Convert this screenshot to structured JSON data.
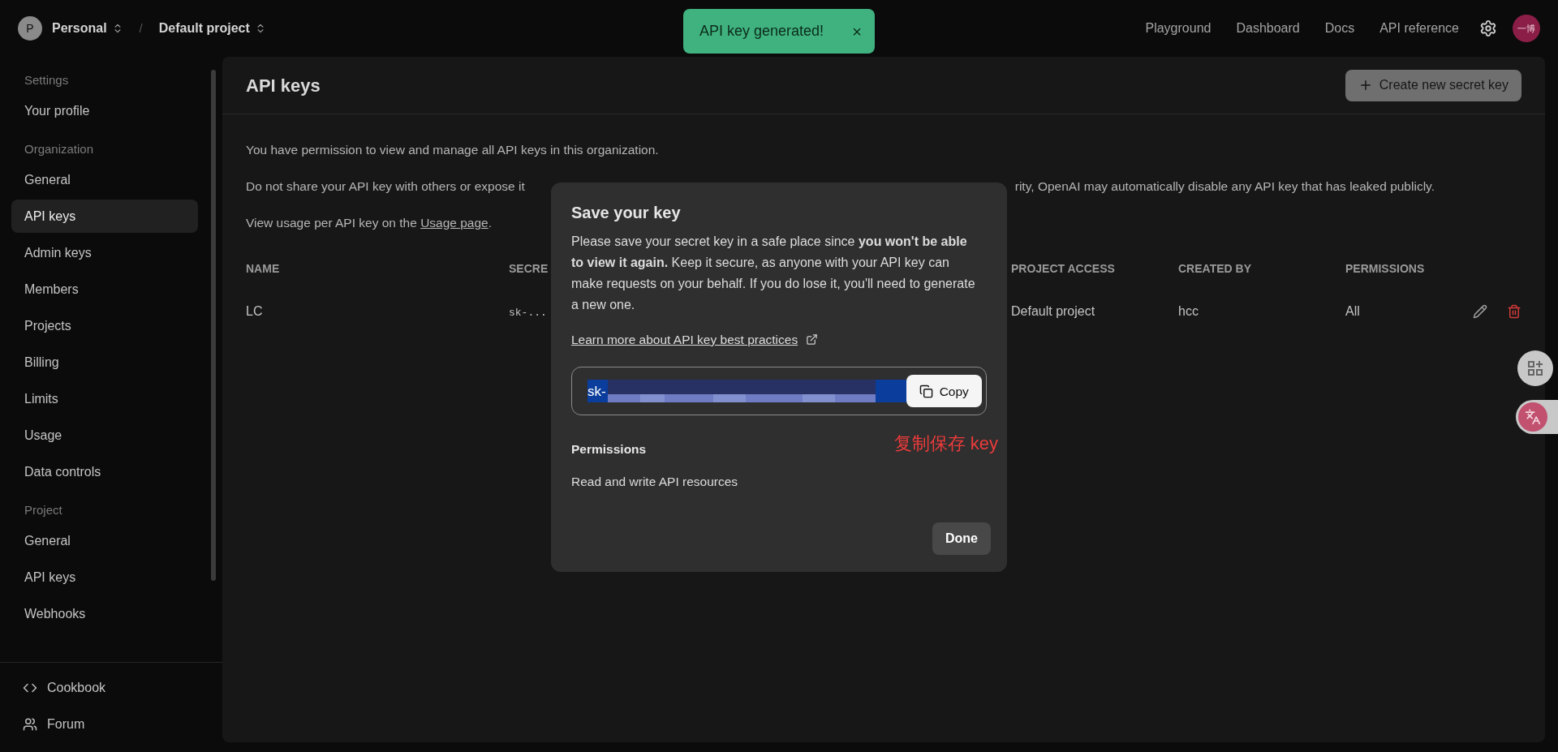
{
  "top_bar": {
    "org": {
      "initial": "P",
      "name": "Personal"
    },
    "separator": "/",
    "project": "Default project",
    "nav": [
      "Playground",
      "Dashboard",
      "Docs",
      "API reference"
    ],
    "avatar": "一博"
  },
  "toast": {
    "message": "API key generated!",
    "close": "×"
  },
  "sidebar": {
    "sections": [
      {
        "heading": "Settings",
        "items": [
          {
            "label": "Your profile",
            "selected": false
          }
        ]
      },
      {
        "heading": "Organization",
        "items": [
          {
            "label": "General",
            "selected": false
          },
          {
            "label": "API keys",
            "selected": true
          },
          {
            "label": "Admin keys",
            "selected": false
          },
          {
            "label": "Members",
            "selected": false
          },
          {
            "label": "Projects",
            "selected": false
          },
          {
            "label": "Billing",
            "selected": false
          },
          {
            "label": "Limits",
            "selected": false
          },
          {
            "label": "Usage",
            "selected": false
          },
          {
            "label": "Data controls",
            "selected": false
          }
        ]
      },
      {
        "heading": "Project",
        "items": [
          {
            "label": "General",
            "selected": false
          },
          {
            "label": "API keys",
            "selected": false
          },
          {
            "label": "Webhooks",
            "selected": false
          }
        ]
      }
    ],
    "footer": [
      {
        "label": "Cookbook",
        "kind": "code"
      },
      {
        "label": "Forum",
        "kind": "users"
      }
    ]
  },
  "page": {
    "title": "API keys",
    "create_button": "Create new secret key",
    "permission_note": "You have permission to view and manage all API keys in this organization.",
    "share_note": {
      "left": "Do not share your API key with others or expose it",
      "right": "rity, OpenAI may automatically disable any API key that has leaked publicly."
    },
    "usage_note": {
      "before": "View usage per API key on the ",
      "link": "Usage page",
      "after": "."
    },
    "table": {
      "columns": [
        "NAME",
        "SECRE",
        "PROJECT ACCESS",
        "CREATED BY",
        "PERMISSIONS"
      ],
      "rows": [
        {
          "name": "LC",
          "secret": "sk-...",
          "project_access": "Default project",
          "created_by": "hcc",
          "permissions": "All"
        }
      ]
    }
  },
  "modal": {
    "title": "Save your key",
    "body": "Please save your secret key in a safe place since **you won't be able to view it again.** Keep it secure, as anyone with your API key can make requests on your behalf. If you do lose it, you'll need to generate a new one.",
    "link": "Learn more about API key best practices",
    "key_prefix": "sk-",
    "copy_button": "Copy",
    "annotation": "复制保存 key",
    "permissions_heading": "Permissions",
    "permissions_text": "Read and write API resources",
    "done_button": "Done"
  }
}
